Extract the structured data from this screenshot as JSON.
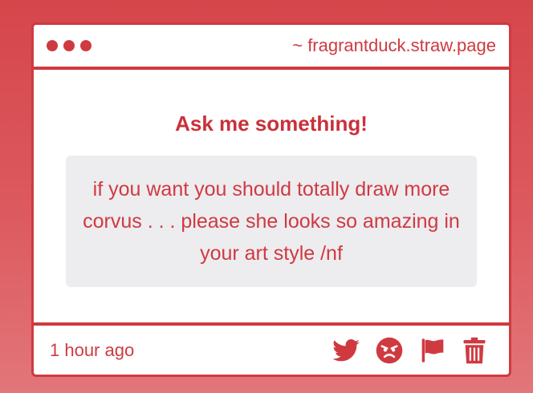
{
  "window": {
    "url": "~ fragrantduck.straw.page"
  },
  "content": {
    "heading": "Ask me something!",
    "question": "if you want you should totally draw more corvus . . . please she looks so amazing in your art style /nf"
  },
  "footer": {
    "timestamp": "1 hour ago",
    "actions": [
      "twitter-icon",
      "angry-face-icon",
      "flag-icon",
      "trash-icon"
    ]
  },
  "colors": {
    "accent": "#cf3a40",
    "background": "#d5464b",
    "question_bg": "#edecef"
  }
}
